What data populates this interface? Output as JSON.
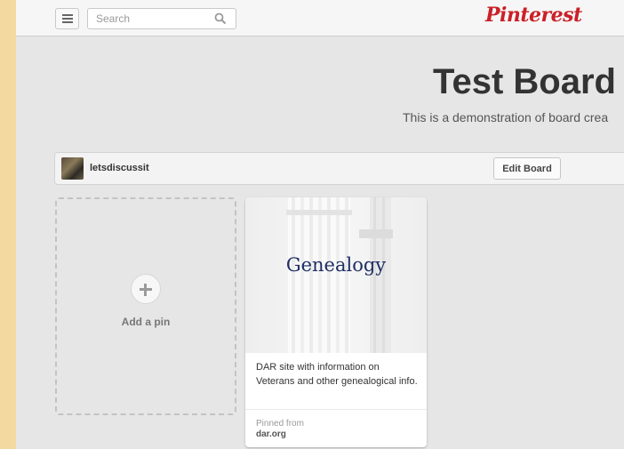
{
  "header": {
    "search_placeholder": "Search",
    "logo_text": "Pinterest"
  },
  "board": {
    "title": "Test Board",
    "description": "This is a demonstration of board crea",
    "owner": "letsdiscussit",
    "edit_button": "Edit Board"
  },
  "add_pin": {
    "label": "Add a pin"
  },
  "pin": {
    "image_caption": "Genealogy",
    "description": "DAR site with information on Veterans and other genealogical info.",
    "pinned_from_label": "Pinned from",
    "source": "dar.org"
  },
  "icons": {
    "menu": "menu-icon",
    "search": "search-icon",
    "add": "plus-icon"
  },
  "colors": {
    "brand": "#cb2027",
    "background": "#e6e6e6",
    "caption": "#1f2e63"
  }
}
